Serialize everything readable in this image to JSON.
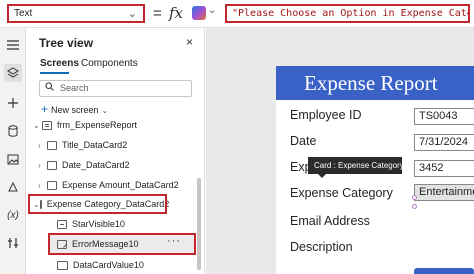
{
  "formula_bar": {
    "property": "Text",
    "equals": "=",
    "fx": "fx",
    "formula": "\"Please Choose an Option in Expense Category\""
  },
  "rail": {
    "icons": [
      "hamburger-icon",
      "layers-icon",
      "insert-plus-icon",
      "data-icon",
      "media-icon",
      "theme-icon",
      "variables-icon",
      "tools-icon"
    ]
  },
  "tree": {
    "title": "Tree view",
    "close": "×",
    "tabs": {
      "screens": "Screens",
      "components": "Components"
    },
    "search_placeholder": "Search",
    "new_screen": "New screen",
    "nodes": {
      "form": "frm_ExpenseReport",
      "title": "Title_DataCard2",
      "date": "Date_DataCard2",
      "amount": "Expense Amount_DataCard2",
      "category": "Expense Category_DataCard2",
      "starvisible": "StarVisible10",
      "error": "ErrorMessage10",
      "datacardvalue": "DataCardValue10"
    },
    "more": "···"
  },
  "canvas": {
    "header": "Expense Report",
    "fields": {
      "employee_label": "Employee ID",
      "employee_value": "TS0043",
      "date_label": "Date",
      "date_value": "7/31/2024",
      "expense_label": "Expense Amount",
      "expense_value": "3452",
      "category_label": "Expense Category",
      "category_value": "Entertainment",
      "email_label": "Email Address",
      "description_label": "Description"
    },
    "tooltip": "Card : Expense Category"
  }
}
